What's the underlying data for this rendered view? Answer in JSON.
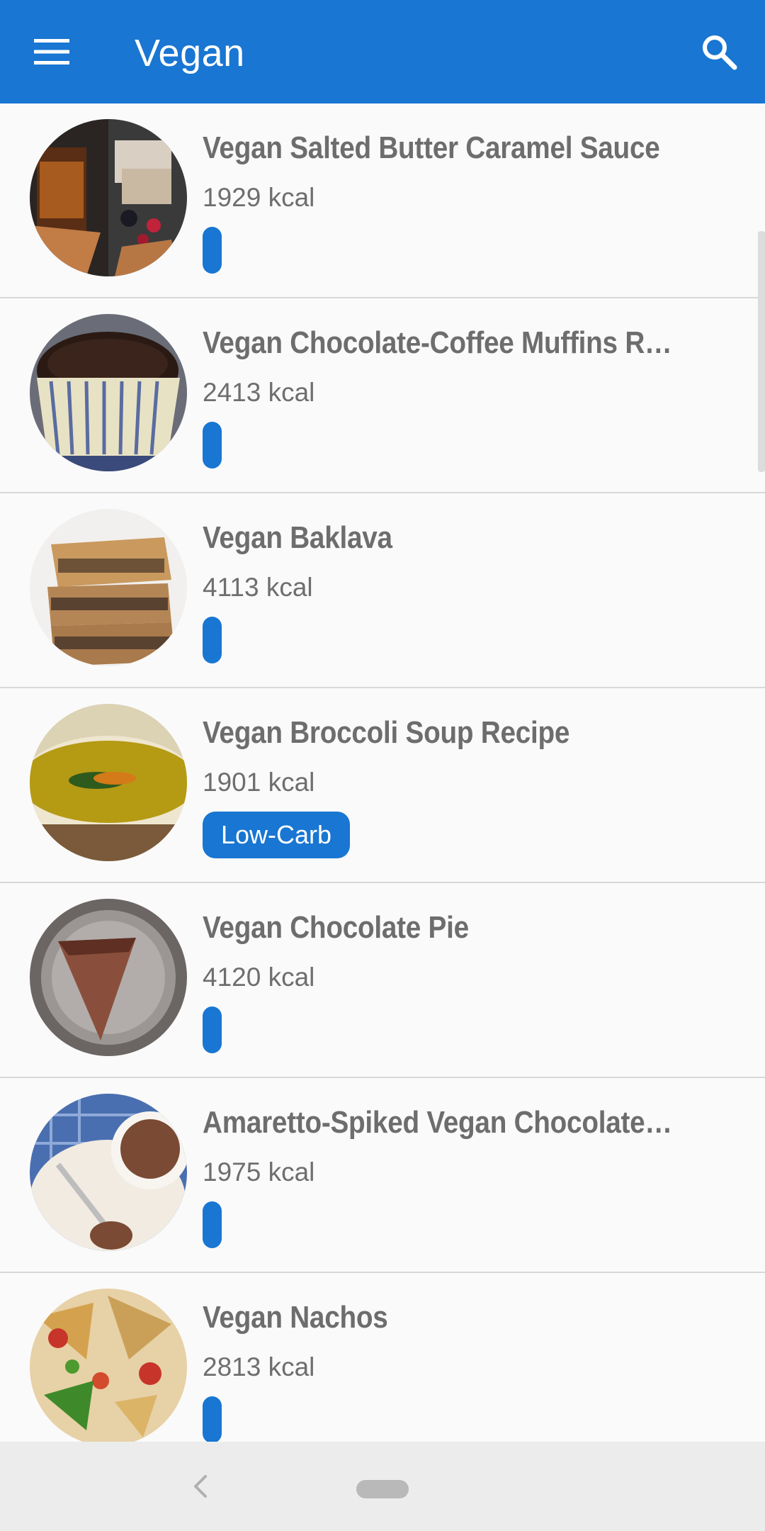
{
  "app_bar": {
    "title": "Vegan",
    "menu_icon": "hamburger-menu-icon",
    "search_icon": "search-icon",
    "color": "#1976d2"
  },
  "recipes": [
    {
      "title": "Vegan Salted Butter Caramel Sauce",
      "kcal": "1929 kcal",
      "tag": ""
    },
    {
      "title": "Vegan Chocolate-Coffee Muffins Reci…",
      "kcal": "2413 kcal",
      "tag": ""
    },
    {
      "title": "Vegan Baklava",
      "kcal": "4113 kcal",
      "tag": ""
    },
    {
      "title": "Vegan Broccoli Soup Recipe",
      "kcal": "1901 kcal",
      "tag": "Low-Carb"
    },
    {
      "title": "Vegan Chocolate Pie",
      "kcal": "4120 kcal",
      "tag": ""
    },
    {
      "title": "Amaretto-Spiked Vegan Chocolate Mo…",
      "kcal": "1975 kcal",
      "tag": ""
    },
    {
      "title": "Vegan Nachos",
      "kcal": "2813 kcal",
      "tag": ""
    }
  ],
  "nav_bar": {
    "back_icon": "back-chevron-icon",
    "home_icon": "home-pill-icon"
  }
}
